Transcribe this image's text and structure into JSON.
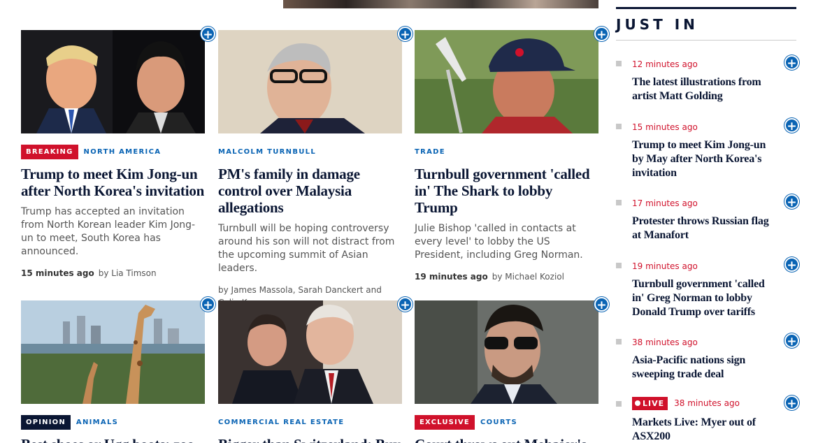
{
  "stories": [
    {
      "badge": "BREAKING",
      "category": "NORTH AMERICA",
      "headline": "Trump to meet Kim Jong-un after North Korea's invitation",
      "summary": "Trump has accepted an invitation from North Korean leader Kim Jong-un to meet, South Korea has announced.",
      "time": "15 minutes ago",
      "byline": "by Lia Timson"
    },
    {
      "badge": "",
      "category": "MALCOLM TURNBULL",
      "headline": "PM's family in damage control over Malaysia allegations",
      "summary": "Turnbull will be hoping controversy around his son will not distract from the upcoming summit of Asian leaders.",
      "time": "",
      "byline": "by James Massola, Sarah Danckert and Colin Kruger"
    },
    {
      "badge": "",
      "category": "TRADE",
      "headline": "Turnbull government 'called in' The Shark to lobby Trump",
      "summary": "Julie Bishop 'called in contacts at every level' to lobby the US President, including Greg Norman.",
      "time": "19 minutes ago",
      "byline": "by Michael Koziol"
    },
    {
      "badge": "OPINION",
      "category": "ANIMALS",
      "headline": "Best shoes or Ugg boots: zoo",
      "summary": "",
      "time": "",
      "byline": ""
    },
    {
      "badge": "",
      "category": "COMMERCIAL REAL ESTATE",
      "headline": "Bigger than Switzerland: Buy",
      "summary": "",
      "time": "",
      "byline": ""
    },
    {
      "badge": "EXCLUSIVE",
      "category": "COURTS",
      "headline": "Court throws out Mehajer's",
      "summary": "",
      "time": "",
      "byline": ""
    }
  ],
  "just_in": {
    "title": "JUST IN",
    "items": [
      {
        "time": "12 minutes ago",
        "live": "",
        "headline": "The latest illustrations from artist Matt Golding"
      },
      {
        "time": "15 minutes ago",
        "live": "",
        "headline": "Trump to meet Kim Jong-un by May after North Korea's invitation"
      },
      {
        "time": "17 minutes ago",
        "live": "",
        "headline": "Protester throws Russian flag at Manafort"
      },
      {
        "time": "19 minutes ago",
        "live": "",
        "headline": "Turnbull government 'called in' Greg Norman to lobby Donald Trump over tariffs"
      },
      {
        "time": "38 minutes ago",
        "live": "",
        "headline": "Asia-Pacific nations sign sweeping trade deal"
      },
      {
        "time": "38 minutes ago",
        "live": "LIVE",
        "headline": "Markets Live: Myer out of ASX200"
      }
    ]
  },
  "icons": {
    "add": "plus-circle-icon",
    "live_dot": "live-dot-icon",
    "bullet": "square-bullet-icon"
  },
  "colors": {
    "accent": "#0a64b4",
    "alert": "#d0112b",
    "ink": "#0a1633"
  }
}
